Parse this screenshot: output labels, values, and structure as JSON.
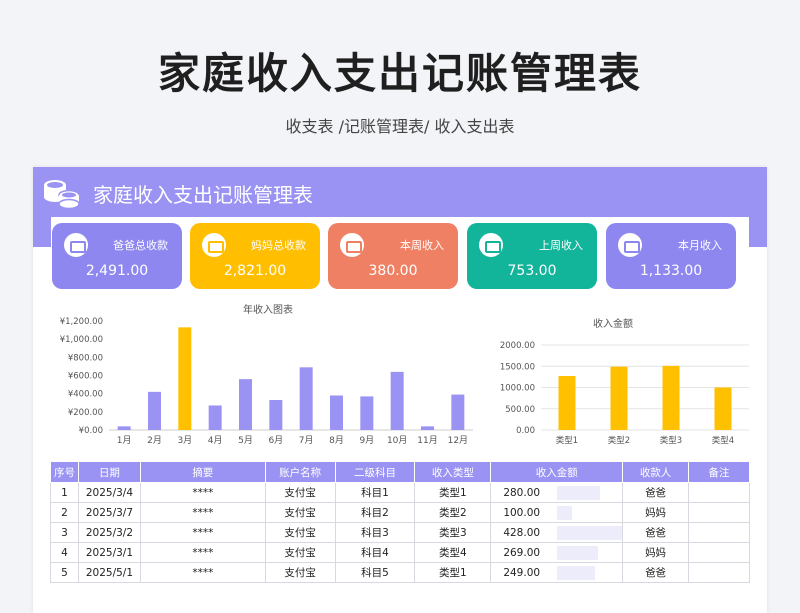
{
  "page": {
    "title": "家庭收入支出记账管理表",
    "subtitle": "收支表 /记账管理表/ 收入支出表"
  },
  "sheet": {
    "title": "家庭收入支出记账管理表"
  },
  "cards": [
    {
      "label": "爸爸总收款",
      "value": "2,491.00",
      "color": "#8e87f0"
    },
    {
      "label": "妈妈总收款",
      "value": "2,821.00",
      "color": "#ffbf00"
    },
    {
      "label": "本周收入",
      "value": "380.00",
      "color": "#f08064"
    },
    {
      "label": "上周收入",
      "value": "753.00",
      "color": "#12b49a"
    },
    {
      "label": "本月收入",
      "value": "1,133.00",
      "color": "#8e87f0"
    }
  ],
  "chart_data": [
    {
      "type": "bar",
      "title": "年收入图表",
      "categories": [
        "1月",
        "2月",
        "3月",
        "4月",
        "5月",
        "6月",
        "7月",
        "8月",
        "9月",
        "10月",
        "11月",
        "12月"
      ],
      "values": [
        40,
        420,
        1130,
        270,
        560,
        330,
        690,
        380,
        370,
        640,
        40,
        390
      ],
      "highlight": [
        false,
        false,
        true,
        false,
        false,
        false,
        false,
        false,
        false,
        false,
        false,
        false
      ],
      "ylim": [
        0,
        1200
      ],
      "yticks": [
        "¥0.00",
        "¥200.00",
        "¥400.00",
        "¥600.00",
        "¥800.00",
        "¥1,000.00",
        "¥1,200.00"
      ],
      "colors": {
        "normal": "#9a93f3",
        "highlight": "#ffc000"
      },
      "grid": false
    },
    {
      "type": "bar",
      "title": "收入金额",
      "categories": [
        "类型1",
        "类型2",
        "类型3",
        "类型4"
      ],
      "values": [
        1270,
        1490,
        1510,
        1000
      ],
      "ylim": [
        0,
        2000
      ],
      "yticks": [
        "0.00",
        "500.00",
        "1000.00",
        "1500.00",
        "2000.00"
      ],
      "colors": {
        "normal": "#ffc000"
      },
      "grid": true
    }
  ],
  "table": {
    "headers": [
      "序号",
      "日期",
      "摘要",
      "账户名称",
      "二级科目",
      "收入类型",
      "收入金额",
      "收款人",
      "备注"
    ],
    "rows": [
      {
        "no": "1",
        "date": "2025/3/4",
        "summary": "****",
        "account": "支付宝",
        "subject": "科目1",
        "type": "类型1",
        "amount": "280.00",
        "amount_value": 280,
        "payee": "爸爸",
        "note": ""
      },
      {
        "no": "2",
        "date": "2025/3/7",
        "summary": "****",
        "account": "支付宝",
        "subject": "科目2",
        "type": "类型2",
        "amount": "100.00",
        "amount_value": 100,
        "payee": "妈妈",
        "note": ""
      },
      {
        "no": "3",
        "date": "2025/3/2",
        "summary": "****",
        "account": "支付宝",
        "subject": "科目3",
        "type": "类型3",
        "amount": "428.00",
        "amount_value": 428,
        "payee": "爸爸",
        "note": ""
      },
      {
        "no": "4",
        "date": "2025/3/1",
        "summary": "****",
        "account": "支付宝",
        "subject": "科目4",
        "type": "类型4",
        "amount": "269.00",
        "amount_value": 269,
        "payee": "妈妈",
        "note": ""
      },
      {
        "no": "5",
        "date": "2025/5/1",
        "summary": "****",
        "account": "支付宝",
        "subject": "科目5",
        "type": "类型1",
        "amount": "249.00",
        "amount_value": 249,
        "payee": "爸爸",
        "note": ""
      }
    ]
  }
}
